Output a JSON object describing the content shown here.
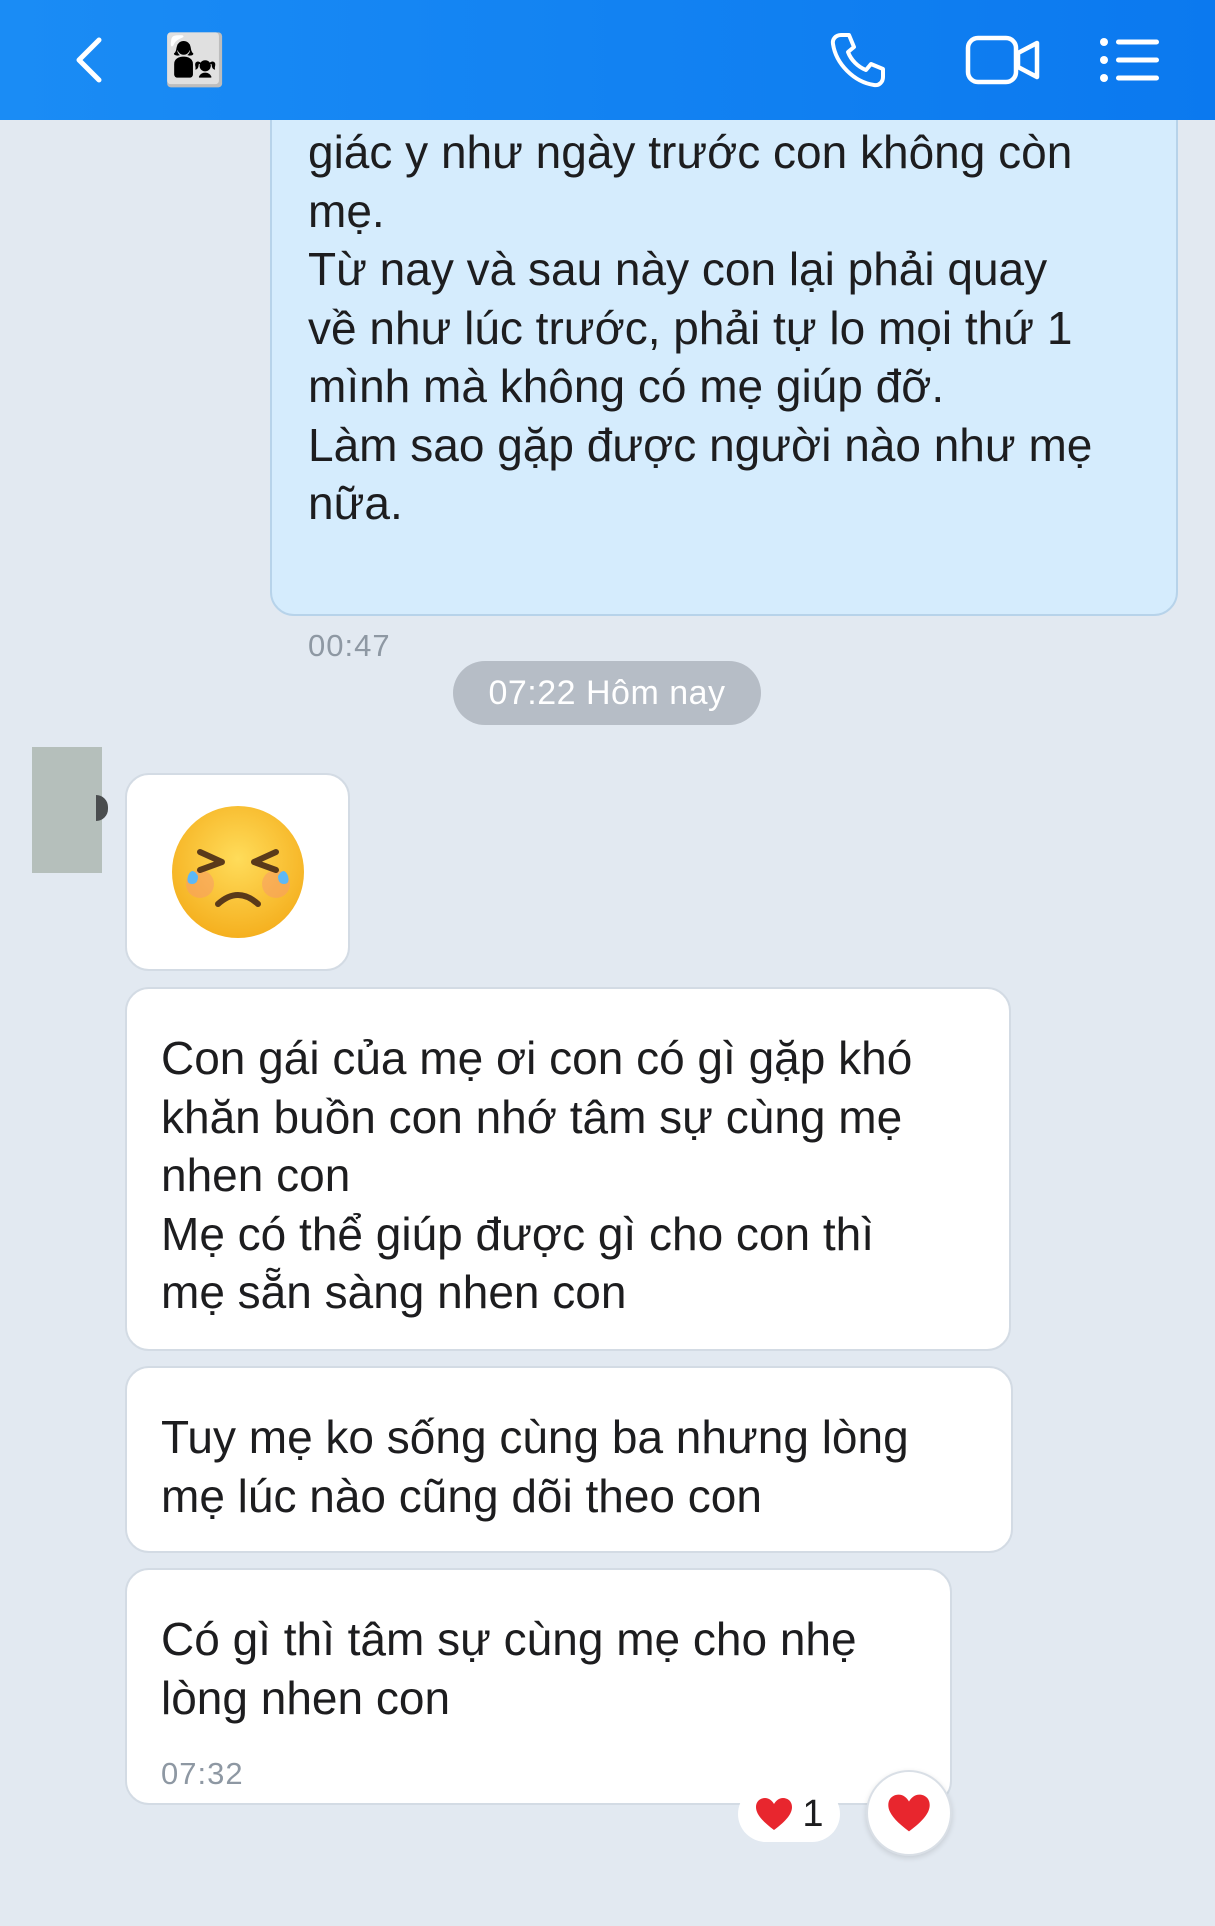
{
  "header": {
    "back_icon": "chevron-left-icon",
    "avatar_icon": "mother-and-child-emoji",
    "avatar_glyph": "👩‍👧",
    "call_icon": "phone-icon",
    "video_icon": "video-camera-icon",
    "menu_icon": "list-menu-icon",
    "bg_color": "#0b80f2"
  },
  "messages": {
    "sent_text": "giác y như ngày trước con không còn\nmẹ.\nTừ nay và sau này con lại phải quay\nvề như lúc trước, phải tự lo mọi thứ 1\nmình mà không có mẹ giúp đỡ.\nLàm sao gặp được người nào như mẹ\nnữa.",
    "sent_time": "00:47",
    "day_separator": "07:22 Hôm nay",
    "emoji": "😣",
    "recv1": "Con gái của mẹ ơi con có gì gặp khó\nkhăn buồn con nhớ tâm sự cùng mẹ\nnhen con\nMẹ có thể giúp được gì cho con thì\nmẹ sẵn sàng nhen con",
    "recv2": "Tuy mẹ ko sống cùng ba nhưng lòng\nmẹ lúc nào cũng dõi theo con",
    "recv3": "Có gì thì tâm sự cùng mẹ cho nhẹ\nlòng nhen con",
    "recv3_time": "07:32"
  },
  "reactions": {
    "heart": "❤️",
    "count": "1",
    "icon": "heart-icon"
  }
}
